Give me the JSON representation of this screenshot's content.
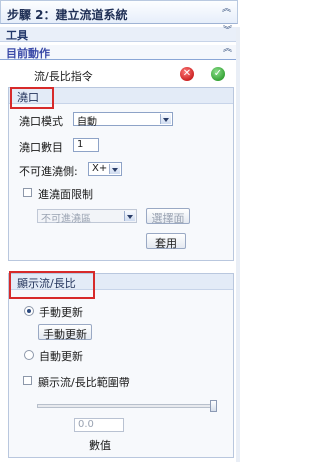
{
  "window": {
    "title": "步驟 2：建立流道系統"
  },
  "sections": {
    "tools": "工具",
    "current_action": "目前動作"
  },
  "command": {
    "label": "流/長比指令"
  },
  "gate_group": {
    "title": "澆口",
    "mode_label": "澆口模式",
    "mode_value": "自動",
    "count_label": "澆口數目",
    "count_value": "1",
    "side_label": "不可進澆側:",
    "side_value": "X+",
    "limit_label": "進澆面限制",
    "area_value": "不可進澆區",
    "select_face_label": "選擇面",
    "apply_label": "套用"
  },
  "flow_group": {
    "title": "顯示流/長比",
    "manual_label": "手動更新",
    "manual_button_label": "手動更新",
    "auto_label": "自動更新",
    "range_label": "顯示流/長比範圍帶",
    "slider_fraction": 1.0,
    "value_field": "0.0",
    "value_label": "數值"
  },
  "icons": {
    "cancel": "cancel-icon",
    "confirm": "confirm-icon"
  },
  "colors": {
    "accent": "#3a4aa8",
    "highlight": "#d72a2a"
  }
}
